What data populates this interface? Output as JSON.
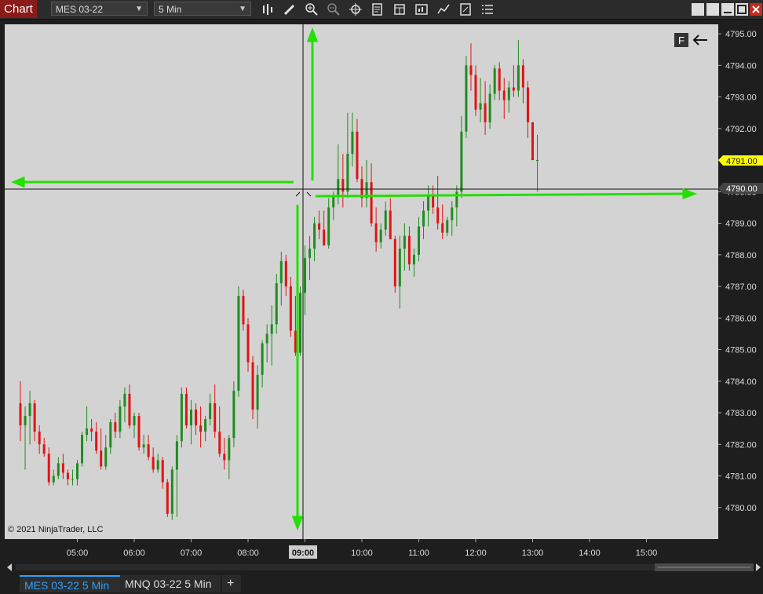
{
  "toolbar": {
    "title": "Chart",
    "instrument": "MES 03-22",
    "interval": "5 Min",
    "icons": [
      "bar-type-icon",
      "draw-icon",
      "zoom-in-icon",
      "zoom-out-icon",
      "crosshair-icon",
      "properties-icon",
      "data-box-icon",
      "strategies-icon",
      "indicators-icon",
      "share-icon",
      "menu-icon"
    ],
    "window_buttons": [
      "restore",
      "maximize",
      "minimize",
      "close"
    ]
  },
  "chart": {
    "copyright": "© 2021 NinjaTrader, LLC",
    "f_marker": "F",
    "last_price_label": "4791.00",
    "crosshair_price_label": "4790.00",
    "crosshair_time_label": "09:00",
    "accent_colors": {
      "up": "#1e8c1e",
      "down": "#e01414",
      "arrows": "#22e000",
      "last_price_bg": "#ffff00"
    }
  },
  "chart_data": {
    "type": "candlestick",
    "x_ticks": [
      "05:00",
      "06:00",
      "07:00",
      "08:00",
      "09:00",
      "10:00",
      "11:00",
      "12:00",
      "13:00",
      "14:00",
      "15:00"
    ],
    "y_ticks": [
      "4795.00",
      "4794.00",
      "4793.00",
      "4792.00",
      "4791.00",
      "4790.00",
      "4789.00",
      "4788.00",
      "4787.00",
      "4786.00",
      "4785.00",
      "4784.00",
      "4783.00",
      "4782.00",
      "4781.00",
      "4780.00"
    ],
    "ylim": [
      4779.0,
      4795.3
    ],
    "candle_interval_minutes": 5,
    "first_candle_time": "04:00",
    "candles": [
      [
        4783.3,
        4784.0,
        4782.1,
        4782.6
      ],
      [
        4782.6,
        4783.2,
        4781.2,
        4782.9
      ],
      [
        4782.9,
        4783.7,
        4782.0,
        4783.3
      ],
      [
        4783.3,
        4783.4,
        4782.1,
        4782.4
      ],
      [
        4782.4,
        4782.6,
        4781.7,
        4782.0
      ],
      [
        4782.0,
        4782.2,
        4781.6,
        4781.7
      ],
      [
        4781.7,
        4781.9,
        4780.7,
        4780.8
      ],
      [
        4780.8,
        4781.2,
        4780.7,
        4781.0
      ],
      [
        4781.0,
        4781.6,
        4780.9,
        4781.4
      ],
      [
        4781.4,
        4781.7,
        4780.9,
        4781.1
      ],
      [
        4781.1,
        4781.2,
        4780.7,
        4780.9
      ],
      [
        4780.9,
        4781.2,
        4780.7,
        4780.9
      ],
      [
        4780.9,
        4781.5,
        4780.7,
        4781.4
      ],
      [
        4781.4,
        4782.4,
        4781.3,
        4782.3
      ],
      [
        4782.3,
        4783.2,
        4782.1,
        4782.5
      ],
      [
        4782.5,
        4782.8,
        4782.1,
        4782.4
      ],
      [
        4782.4,
        4782.7,
        4781.7,
        4781.8
      ],
      [
        4781.8,
        4782.5,
        4781.2,
        4781.3
      ],
      [
        4781.3,
        4782.3,
        4781.2,
        4781.9
      ],
      [
        4781.9,
        4782.8,
        4781.7,
        4782.7
      ],
      [
        4782.7,
        4783.0,
        4782.2,
        4782.4
      ],
      [
        4782.4,
        4783.4,
        4782.2,
        4783.2
      ],
      [
        4783.2,
        4783.8,
        4782.7,
        4783.6
      ],
      [
        4783.6,
        4783.9,
        4782.5,
        4782.6
      ],
      [
        4782.6,
        4783.0,
        4782.2,
        4782.9
      ],
      [
        4782.9,
        4783.0,
        4781.8,
        4781.9
      ],
      [
        4781.9,
        4782.3,
        4781.7,
        4782.0
      ],
      [
        4782.0,
        4782.3,
        4781.5,
        4781.6
      ],
      [
        4781.6,
        4781.9,
        4781.1,
        4781.2
      ],
      [
        4781.2,
        4781.7,
        4781.1,
        4781.5
      ],
      [
        4781.5,
        4781.6,
        4780.6,
        4780.8
      ],
      [
        4780.8,
        4780.9,
        4779.7,
        4779.8
      ],
      [
        4779.8,
        4781.3,
        4779.6,
        4781.2
      ],
      [
        4781.2,
        4782.3,
        4779.7,
        4782.1
      ],
      [
        4782.1,
        4783.8,
        4781.9,
        4783.6
      ],
      [
        4783.6,
        4783.8,
        4782.5,
        4782.6
      ],
      [
        4782.6,
        4783.4,
        4782.0,
        4783.1
      ],
      [
        4783.1,
        4783.3,
        4782.3,
        4782.6
      ],
      [
        4782.6,
        4783.2,
        4781.9,
        4782.4
      ],
      [
        4782.4,
        4782.9,
        4782.1,
        4782.8
      ],
      [
        4782.8,
        4783.6,
        4782.6,
        4783.3
      ],
      [
        4783.3,
        4783.9,
        4782.2,
        4782.4
      ],
      [
        4782.4,
        4783.2,
        4781.6,
        4781.7
      ],
      [
        4781.7,
        4782.2,
        4781.2,
        4781.5
      ],
      [
        4781.5,
        4782.3,
        4780.9,
        4782.2
      ],
      [
        4782.2,
        4784.0,
        4781.9,
        4783.7
      ],
      [
        4783.7,
        4787.0,
        4783.5,
        4786.7
      ],
      [
        4786.7,
        4786.9,
        4785.6,
        4785.8
      ],
      [
        4785.8,
        4786.0,
        4784.3,
        4784.6
      ],
      [
        4784.6,
        4784.8,
        4782.8,
        4783.1
      ],
      [
        4783.1,
        4784.5,
        4782.5,
        4784.2
      ],
      [
        4784.2,
        4785.3,
        4783.8,
        4785.2
      ],
      [
        4785.2,
        4785.8,
        4784.6,
        4785.5
      ],
      [
        4785.5,
        4786.4,
        4784.5,
        4785.8
      ],
      [
        4785.8,
        4787.4,
        4785.5,
        4787.1
      ],
      [
        4787.1,
        4788.1,
        4786.4,
        4787.8
      ],
      [
        4787.8,
        4788.0,
        4786.7,
        4787.0
      ],
      [
        4787.0,
        4787.3,
        4785.4,
        4785.6
      ],
      [
        4785.6,
        4786.7,
        4784.8,
        4784.9
      ],
      [
        4784.9,
        4787.0,
        4784.8,
        4786.8
      ],
      [
        4786.8,
        4788.3,
        4786.1,
        4787.9
      ],
      [
        4787.9,
        4788.6,
        4787.2,
        4788.2
      ],
      [
        4788.2,
        4789.2,
        4787.8,
        4789.0
      ],
      [
        4789.0,
        4789.4,
        4788.5,
        4788.8
      ],
      [
        4788.8,
        4789.4,
        4788.3,
        4788.3
      ],
      [
        4788.3,
        4789.8,
        4788.2,
        4789.5
      ],
      [
        4789.5,
        4790.0,
        4789.1,
        4789.9
      ],
      [
        4789.9,
        4791.5,
        4789.6,
        4790.4
      ],
      [
        4790.4,
        4791.2,
        4789.5,
        4790.0
      ],
      [
        4790.0,
        4792.5,
        4789.8,
        4791.2
      ],
      [
        4791.2,
        4792.5,
        4790.8,
        4791.9
      ],
      [
        4791.9,
        4792.3,
        4790.3,
        4790.4
      ],
      [
        4790.4,
        4790.8,
        4789.5,
        4789.8
      ],
      [
        4789.8,
        4791.0,
        4789.5,
        4790.3
      ],
      [
        4790.3,
        4790.9,
        4788.9,
        4789.0
      ],
      [
        4789.0,
        4789.5,
        4788.1,
        4788.4
      ],
      [
        4788.4,
        4789.0,
        4788.2,
        4788.8
      ],
      [
        4788.8,
        4789.7,
        4788.6,
        4789.4
      ],
      [
        4789.4,
        4789.8,
        4788.5,
        4788.5
      ],
      [
        4788.5,
        4788.6,
        4786.8,
        4787.0
      ],
      [
        4787.0,
        4788.6,
        4786.3,
        4788.2
      ],
      [
        4788.2,
        4789.0,
        4787.5,
        4788.6
      ],
      [
        4788.6,
        4788.9,
        4787.5,
        4787.7
      ],
      [
        4787.7,
        4788.2,
        4787.3,
        4788.0
      ],
      [
        4788.0,
        4789.2,
        4787.8,
        4788.9
      ],
      [
        4788.9,
        4789.7,
        4788.5,
        4789.4
      ],
      [
        4789.4,
        4790.2,
        4788.9,
        4789.9
      ],
      [
        4789.9,
        4790.2,
        4789.3,
        4789.5
      ],
      [
        4789.5,
        4790.5,
        4788.8,
        4789.0
      ],
      [
        4789.0,
        4789.6,
        4788.5,
        4788.7
      ],
      [
        4788.7,
        4789.2,
        4788.6,
        4789.1
      ],
      [
        4789.1,
        4789.7,
        4788.6,
        4789.5
      ],
      [
        4789.5,
        4790.2,
        4788.9,
        4790.0
      ],
      [
        4790.0,
        4792.4,
        4789.8,
        4791.9
      ],
      [
        4791.9,
        4794.3,
        4791.7,
        4794.0
      ],
      [
        4794.0,
        4794.7,
        4793.2,
        4793.7
      ],
      [
        4793.7,
        4794.0,
        4792.4,
        4792.6
      ],
      [
        4792.6,
        4793.6,
        4792.2,
        4792.8
      ],
      [
        4792.8,
        4793.5,
        4791.8,
        4792.2
      ],
      [
        4792.2,
        4793.4,
        4792.0,
        4793.1
      ],
      [
        4793.1,
        4794.0,
        4792.9,
        4793.9
      ],
      [
        4793.9,
        4794.1,
        4792.9,
        4793.2
      ],
      [
        4793.2,
        4793.6,
        4792.3,
        4792.9
      ],
      [
        4792.9,
        4793.5,
        4792.5,
        4793.3
      ],
      [
        4793.3,
        4794.0,
        4793.0,
        4793.2
      ],
      [
        4793.2,
        4794.8,
        4793.0,
        4794.0
      ],
      [
        4794.0,
        4794.2,
        4792.8,
        4793.3
      ],
      [
        4793.3,
        4793.5,
        4791.7,
        4792.2
      ],
      [
        4792.2,
        4792.2,
        4791.0,
        4791.0
      ],
      [
        4791.0,
        4791.8,
        4790.0,
        4791.0
      ]
    ]
  }
}
